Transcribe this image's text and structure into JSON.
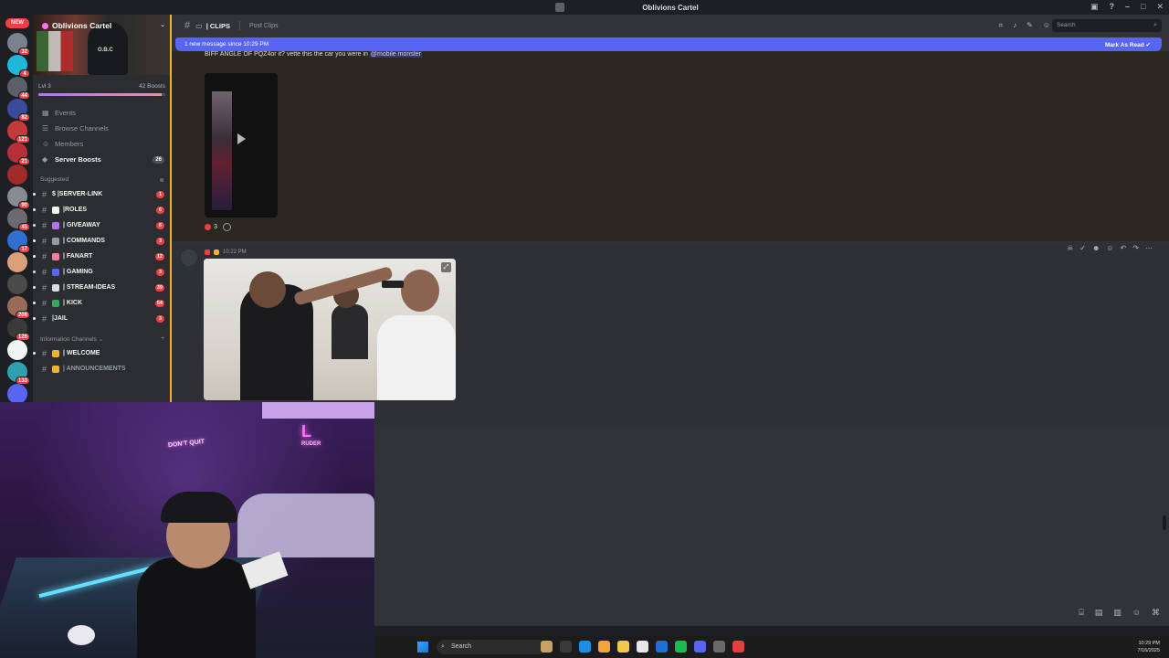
{
  "window": {
    "title": "Oblivions Cartel"
  },
  "rail": {
    "new_badge": "NEW",
    "servers": [
      {
        "name": "srv-1",
        "badge": "32",
        "color": "#7a8290"
      },
      {
        "name": "srv-2",
        "badge": "4",
        "color": "#1fb7d9"
      },
      {
        "name": "srv-3",
        "badge": "44",
        "color": "#5a5f6a"
      },
      {
        "name": "srv-4",
        "badge": "82",
        "color": "#3b4a9a"
      },
      {
        "name": "srv-5",
        "badge": "121",
        "color": "#c23a3a"
      },
      {
        "name": "srv-6",
        "badge": "21",
        "color": "#b82f3a"
      },
      {
        "name": "srv-7",
        "badge": "",
        "color": "#a12a2a"
      },
      {
        "name": "srv-8",
        "badge": "90",
        "color": "#8a8a94"
      },
      {
        "name": "srv-9",
        "badge": "45",
        "color": "#6a6a70"
      },
      {
        "name": "srv-10",
        "badge": "17",
        "color": "#2f6fd0"
      },
      {
        "name": "srv-11",
        "badge": "",
        "color": "#d9a07a"
      },
      {
        "name": "srv-12",
        "badge": "",
        "color": "#4a4a4a"
      },
      {
        "name": "srv-13",
        "badge": "208",
        "color": "#9a6a5a"
      },
      {
        "name": "srv-14",
        "badge": "126",
        "color": "#3a3a3a"
      },
      {
        "name": "srv-15",
        "badge": "",
        "color": "#f2f3f5"
      },
      {
        "name": "srv-16",
        "badge": "133",
        "color": "#2fa0b0"
      },
      {
        "name": "srv-17",
        "badge": "",
        "color": "#5865f2"
      }
    ]
  },
  "server": {
    "name": "Oblivions Cartel",
    "banner_text": "O.B.C",
    "level": "Lvl 3",
    "boosts": "42 Boosts",
    "boost_progress": 0.97
  },
  "menu": [
    {
      "label": "Events",
      "icon": "calendar-icon",
      "glyph": "▦",
      "count": ""
    },
    {
      "label": "Browse Channels",
      "icon": "browse-icon",
      "glyph": "☰",
      "count": ""
    },
    {
      "label": "Members",
      "icon": "members-icon",
      "glyph": "☺",
      "count": ""
    },
    {
      "label": "Server Boosts",
      "icon": "boost-icon",
      "glyph": "◆",
      "count": "26"
    }
  ],
  "sections": {
    "suggested": "Suggested",
    "information": "Information Channels"
  },
  "channels_suggested": [
    {
      "label": "$ |SERVER-LINK",
      "mention": "1",
      "emoji_color": ""
    },
    {
      "label": "|ROLES",
      "mention": "6",
      "emoji_color": "#f2f3f5"
    },
    {
      "label": "| GIVEAWAY",
      "mention": "6",
      "emoji_color": "#b473f5"
    },
    {
      "label": "| COMMANDS",
      "mention": "3",
      "emoji_color": "#949ba4"
    },
    {
      "label": "| FANART",
      "mention": "12",
      "emoji_color": "#f47fa4"
    },
    {
      "label": "| GAMING",
      "mention": "3",
      "emoji_color": "#5865f2"
    },
    {
      "label": "| STREAM-IDEAS",
      "mention": "39",
      "emoji_color": "#dbdee1"
    },
    {
      "label": "| KICK",
      "mention": "54",
      "emoji_color": "#3ba55c"
    },
    {
      "label": "|JAIL",
      "mention": "3",
      "emoji_color": ""
    }
  ],
  "channels_info": [
    {
      "label": "| WELCOME",
      "emoji_color": "#f0b232",
      "muted": false
    },
    {
      "label": "| ANNOUNCEMENTS",
      "emoji_color": "#f0b232",
      "muted": true
    }
  ],
  "header": {
    "channel": "| CLIPS",
    "topic": "Post Clips",
    "search_placeholder": "Search"
  },
  "new_message_bar": {
    "text": "1 new message since 10:29 PM",
    "action": "Mark As Read"
  },
  "message1": {
    "text": "BIFF ANGLE OF PQZ4or it? vette this the car you were in",
    "mention": "@mobile monster",
    "reaction_count": "3"
  },
  "message2": {
    "timestamp": "10:22 PM"
  },
  "cam": {
    "sign_left": "DON'T QUIT",
    "sign_right": "L",
    "sign_right_sub": "RUDER"
  },
  "taskbar": {
    "search_placeholder": "Search",
    "time": "10:29 PM",
    "date": "7/16/2025",
    "apps": [
      "#c9a26a",
      "#3a3a3a",
      "#1d8fe1",
      "#f2a33a",
      "#f2c84b",
      "#e8e8e8",
      "#1f6fd6",
      "#1db954",
      "#5865f2",
      "#6a6a6a",
      "#e04040"
    ]
  },
  "colors": {
    "accent": "#5865f2",
    "boost_border": "#f0b232",
    "mention": "#f23f43"
  }
}
